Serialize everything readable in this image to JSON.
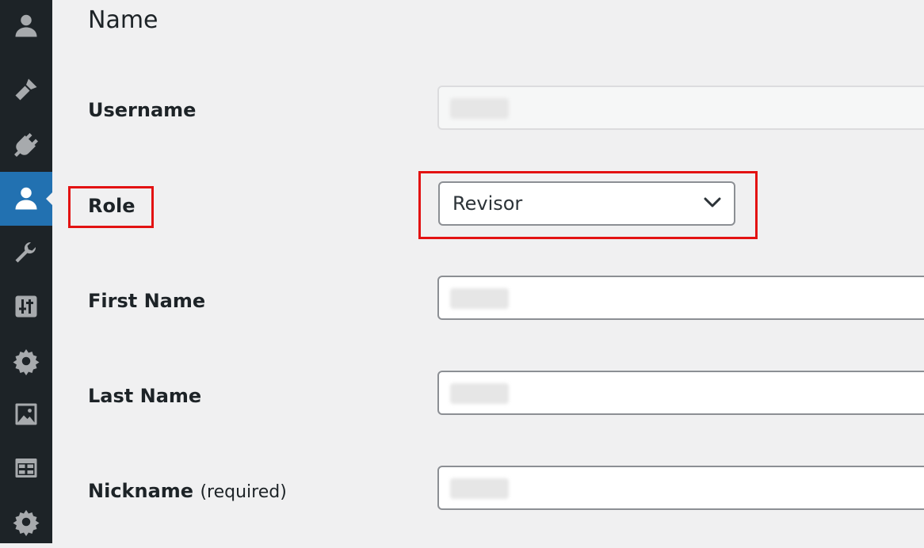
{
  "section": {
    "title": "Name"
  },
  "fields": {
    "username": {
      "label": "Username"
    },
    "role": {
      "label": "Role",
      "selected": "Revisor"
    },
    "first_name": {
      "label": "First Name"
    },
    "last_name": {
      "label": "Last Name"
    },
    "nickname": {
      "label": "Nickname",
      "suffix": "(required)"
    }
  },
  "sidebar": {
    "icons": [
      "user-icon",
      "brush-icon",
      "plugin-icon",
      "users-icon",
      "wrench-icon",
      "sliders-icon",
      "gear-icon",
      "image-icon",
      "table-icon",
      "gear-icon"
    ],
    "active": "users-icon"
  },
  "colors": {
    "sidebar_bg": "#1d2327",
    "active_bg": "#2271b1",
    "highlight": "#e31212",
    "page_bg": "#f0f0f1"
  }
}
